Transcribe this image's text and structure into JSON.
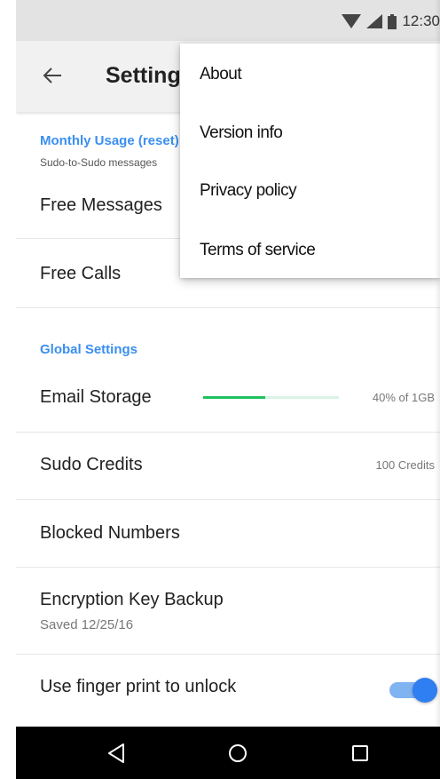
{
  "status_bar": {
    "time": "12:30",
    "icons": [
      "wifi-icon",
      "signal-icon",
      "battery-icon"
    ]
  },
  "app_bar": {
    "back_icon": "arrow-left-icon",
    "title": "Settings"
  },
  "overflow_menu": {
    "items": [
      "About",
      "Version info",
      "Privacy policy",
      "Terms of service"
    ]
  },
  "monthly_usage": {
    "header": "Monthly Usage (reset)",
    "subtitle": "Sudo-to-Sudo messages",
    "free_messages_label": "Free Messages",
    "free_calls_label": "Free Calls"
  },
  "global_settings": {
    "header": "Global Settings",
    "email_storage": {
      "label": "Email Storage",
      "value": "40% of 1GB",
      "progress": 0.46
    },
    "sudo_credits": {
      "label": "Sudo Credits",
      "value": "100 Credits"
    },
    "blocked_numbers": {
      "label": "Blocked Numbers"
    },
    "encryption_backup": {
      "label": "Encryption Key Backup",
      "subtitle": "Saved 12/25/16"
    },
    "fingerprint": {
      "label": "Use finger print to unlock",
      "enabled": true
    }
  },
  "nav_bar": {
    "buttons": [
      "back-triangle-icon",
      "home-circle-icon",
      "recents-square-icon"
    ]
  },
  "colors": {
    "accent_blue": "#3a8ff0",
    "progress_green": "#1fc15f",
    "toggle_blue": "#2f7ef2"
  }
}
